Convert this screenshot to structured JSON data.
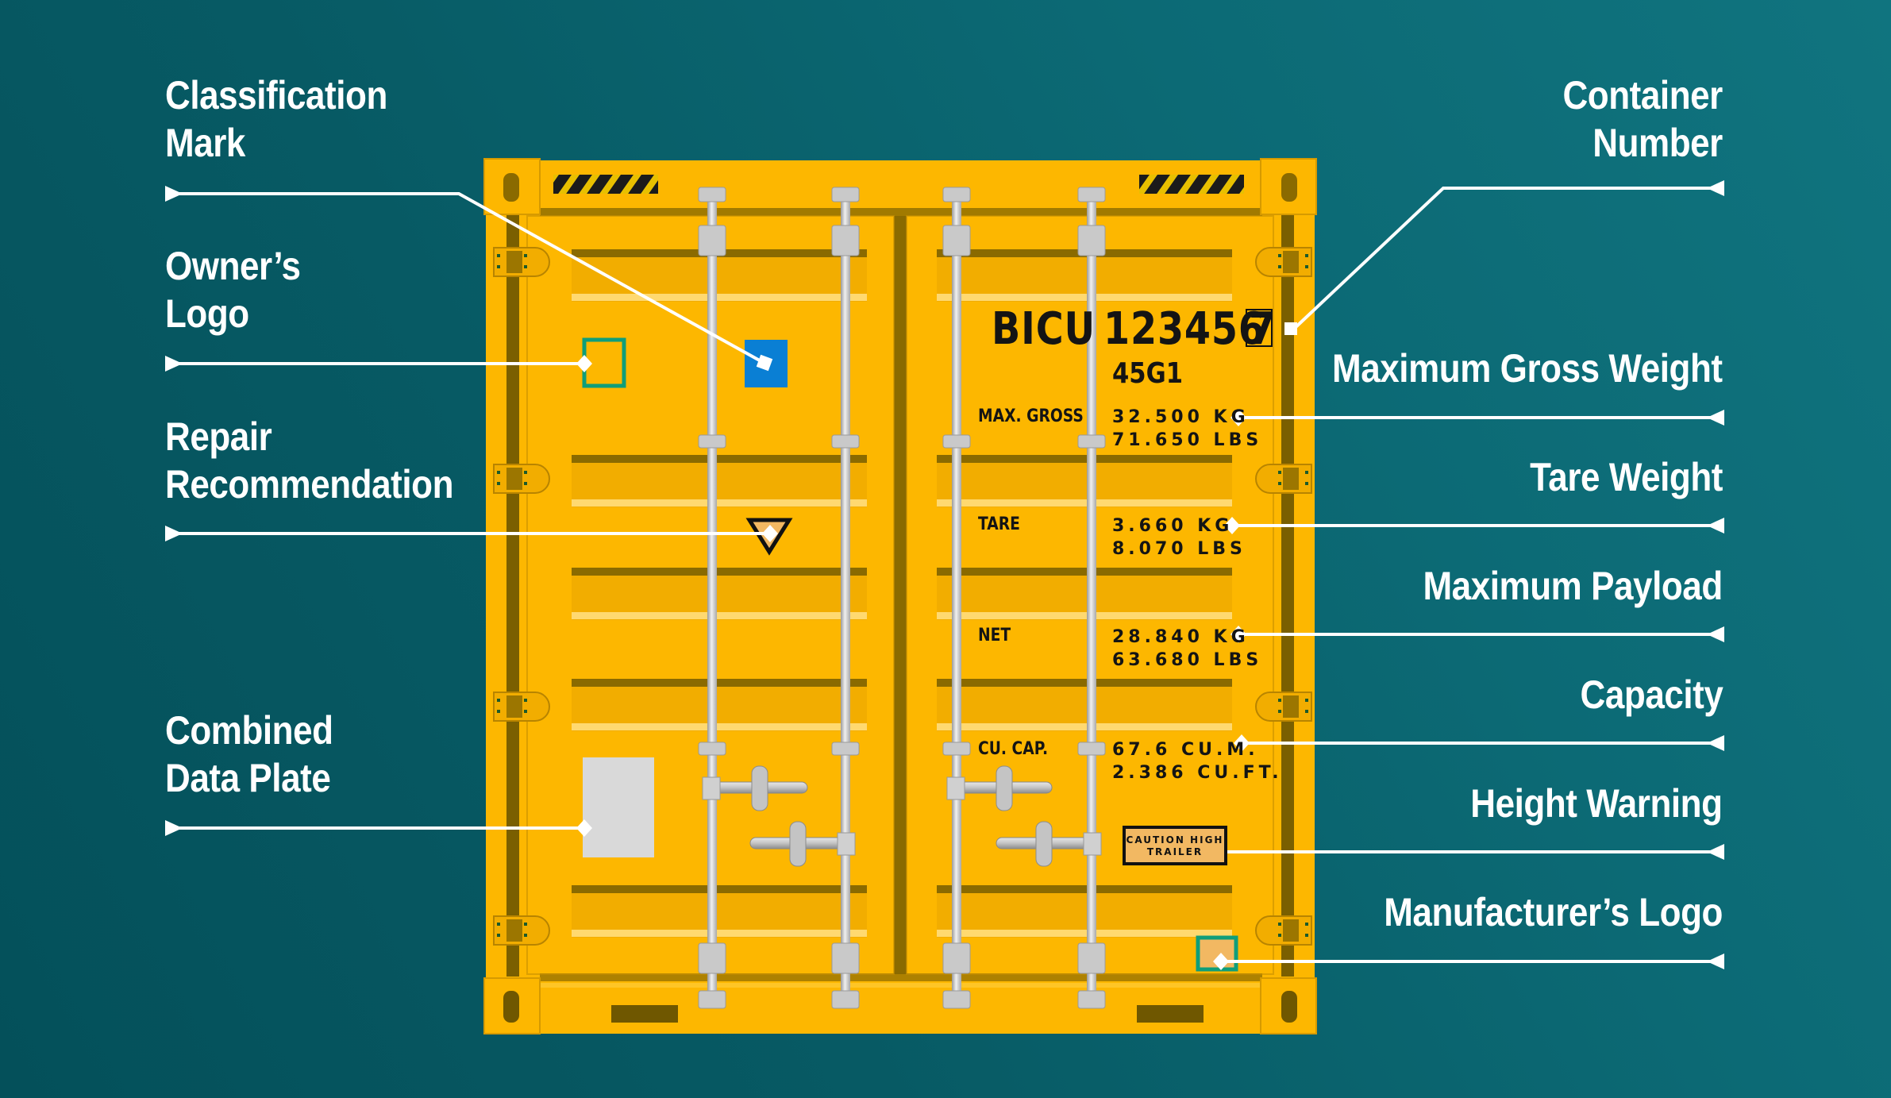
{
  "colors": {
    "background_dark": "#04505a",
    "background_light": "#10747f",
    "container_yellow": "#fdb700",
    "container_shadow": "#7a5f00",
    "classification_mark": "#0a7fd4",
    "logo_frame": "#0f9e7a",
    "data_plate": "#d9d9d9",
    "sticker": "#f2b862",
    "leader_line": "#ffffff"
  },
  "labels_left": [
    {
      "id": "classification-mark",
      "lines": [
        "Classification",
        "Mark"
      ]
    },
    {
      "id": "owners-logo",
      "lines": [
        "Owner’s",
        "Logo"
      ]
    },
    {
      "id": "repair-recommendation",
      "lines": [
        "Repair",
        "Recommendation"
      ]
    },
    {
      "id": "combined-data-plate",
      "lines": [
        "Combined",
        "Data Plate"
      ]
    }
  ],
  "labels_right": [
    {
      "id": "container-number",
      "lines": [
        "Container",
        "Number"
      ]
    },
    {
      "id": "maximum-gross-weight",
      "lines": [
        "Maximum Gross Weight"
      ]
    },
    {
      "id": "tare-weight",
      "lines": [
        "Tare Weight"
      ]
    },
    {
      "id": "maximum-payload",
      "lines": [
        "Maximum Payload"
      ]
    },
    {
      "id": "capacity",
      "lines": [
        "Capacity"
      ]
    },
    {
      "id": "height-warning",
      "lines": [
        "Height Warning"
      ]
    },
    {
      "id": "manufacturers-logo",
      "lines": [
        "Manufacturer’s Logo"
      ]
    }
  ],
  "container": {
    "owner_code": "BICU",
    "serial_number": "123456",
    "check_digit": "7",
    "type_code": "45G1",
    "specs": [
      {
        "label": "MAX. GROSS",
        "kg": "32.500 KG",
        "lbs": "71.650 LBS"
      },
      {
        "label": "TARE",
        "kg": "3.660 KG",
        "lbs": "8.070 LBS"
      },
      {
        "label": "NET",
        "kg": "28.840 KG",
        "lbs": "63.680 LBS"
      },
      {
        "label": "CU. CAP.",
        "kg": "67.6 CU.M.",
        "lbs": "2.386 CU.FT."
      }
    ],
    "caution_sticker": [
      "CAUTION HIGH",
      "TRAILER"
    ]
  }
}
